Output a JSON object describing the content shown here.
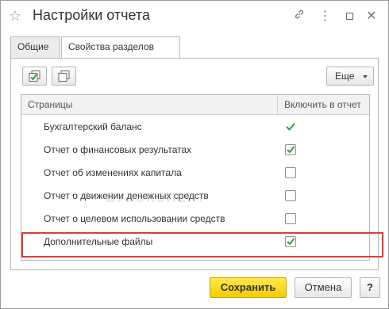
{
  "window": {
    "title": "Настройки отчета",
    "star_glyph": "☆",
    "more_glyph": "⋮",
    "close_glyph": "✕"
  },
  "tabs": [
    {
      "label": "Общие",
      "active": false
    },
    {
      "label": "Свойства разделов",
      "active": true
    }
  ],
  "toolbar": {
    "more_label": "Еще"
  },
  "table": {
    "headers": [
      "Страницы",
      "Включить в отчет"
    ],
    "rows": [
      {
        "label": "Бухгалтерский баланс",
        "checked": true,
        "style": "plain"
      },
      {
        "label": "Отчет о финансовых результатах",
        "checked": true,
        "style": "box"
      },
      {
        "label": "Отчет об изменениях капитала",
        "checked": false,
        "style": "box"
      },
      {
        "label": "Отчет о движении денежных средств",
        "checked": false,
        "style": "box"
      },
      {
        "label": "Отчет о целевом использовании средств",
        "checked": false,
        "style": "box"
      },
      {
        "label": "Дополнительные файлы",
        "checked": true,
        "style": "box"
      }
    ]
  },
  "watermark": "БУХЭКСПЕРТ",
  "footer": {
    "save_label": "Сохранить",
    "cancel_label": "Отмена",
    "help_label": "?"
  },
  "colors": {
    "check_green": "#2e9e3e",
    "highlight_red": "#e53935",
    "save_yellow": "#f5cc00"
  }
}
